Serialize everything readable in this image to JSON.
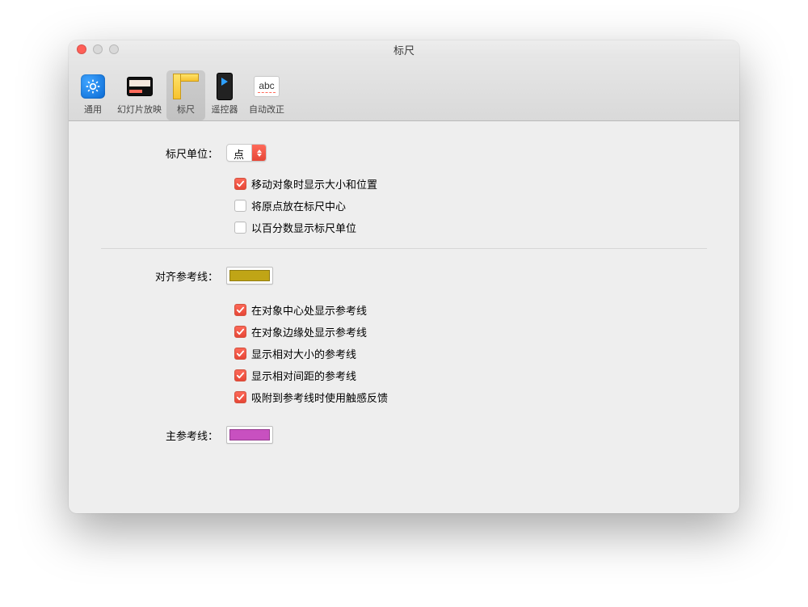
{
  "window": {
    "title": "标尺"
  },
  "toolbar": {
    "items": [
      {
        "label": "通用"
      },
      {
        "label": "幻灯片放映"
      },
      {
        "label": "标尺"
      },
      {
        "label": "遥控器"
      },
      {
        "label": "自动改正"
      }
    ],
    "selected_index": 2,
    "autocorrect_glyph": "abc"
  },
  "section_units": {
    "label": "标尺单位：",
    "value": "点",
    "checks": [
      {
        "checked": true,
        "label": "移动对象时显示大小和位置"
      },
      {
        "checked": false,
        "label": "将原点放在标尺中心"
      },
      {
        "checked": false,
        "label": "以百分数显示标尺单位"
      }
    ]
  },
  "section_guides": {
    "label": "对齐参考线：",
    "color": "#c0a516",
    "checks": [
      {
        "checked": true,
        "label": "在对象中心处显示参考线"
      },
      {
        "checked": true,
        "label": "在对象边缘处显示参考线"
      },
      {
        "checked": true,
        "label": "显示相对大小的参考线"
      },
      {
        "checked": true,
        "label": "显示相对间距的参考线"
      },
      {
        "checked": true,
        "label": "吸附到参考线时使用触感反馈"
      }
    ]
  },
  "section_main_guides": {
    "label": "主参考线：",
    "color": "#c850c0"
  }
}
